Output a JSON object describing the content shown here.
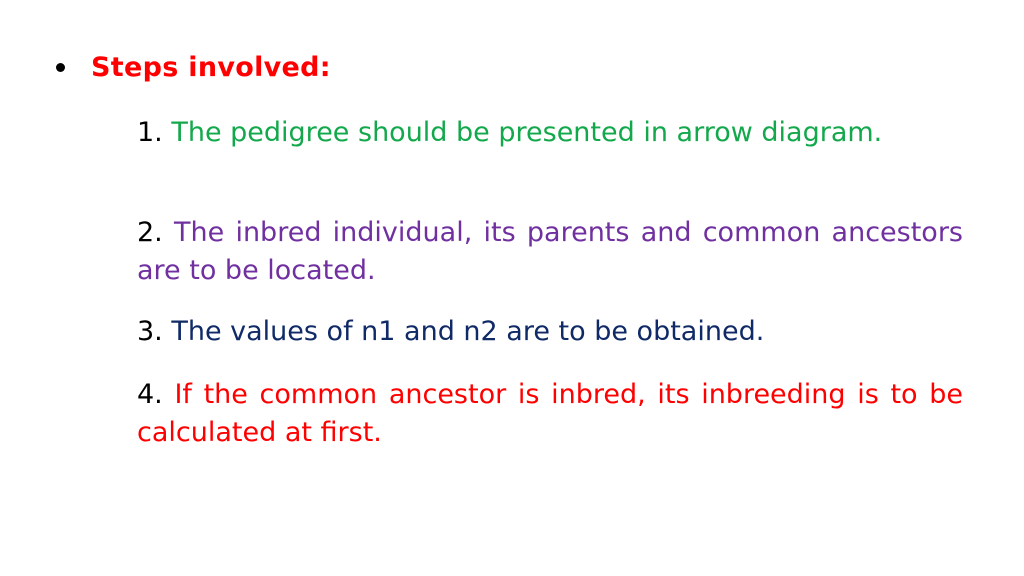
{
  "heading": "Steps involved:",
  "steps": [
    {
      "number": "1.",
      "text": "The pedigree should be presented in arrow diagram.",
      "color": "#13a84b"
    },
    {
      "number": "2.",
      "text": "The inbred individual, its parents and common ancestors are to be located.",
      "color": "#7030a0"
    },
    {
      "number": "3.",
      "text": "The values of n1 and n2 are to be obtained.",
      "color": "#0f2a66"
    },
    {
      "number": "4.",
      "text": "If the common ancestor is inbred, its inbreeding is to be calculated at first.",
      "color": "#ff0000"
    }
  ]
}
